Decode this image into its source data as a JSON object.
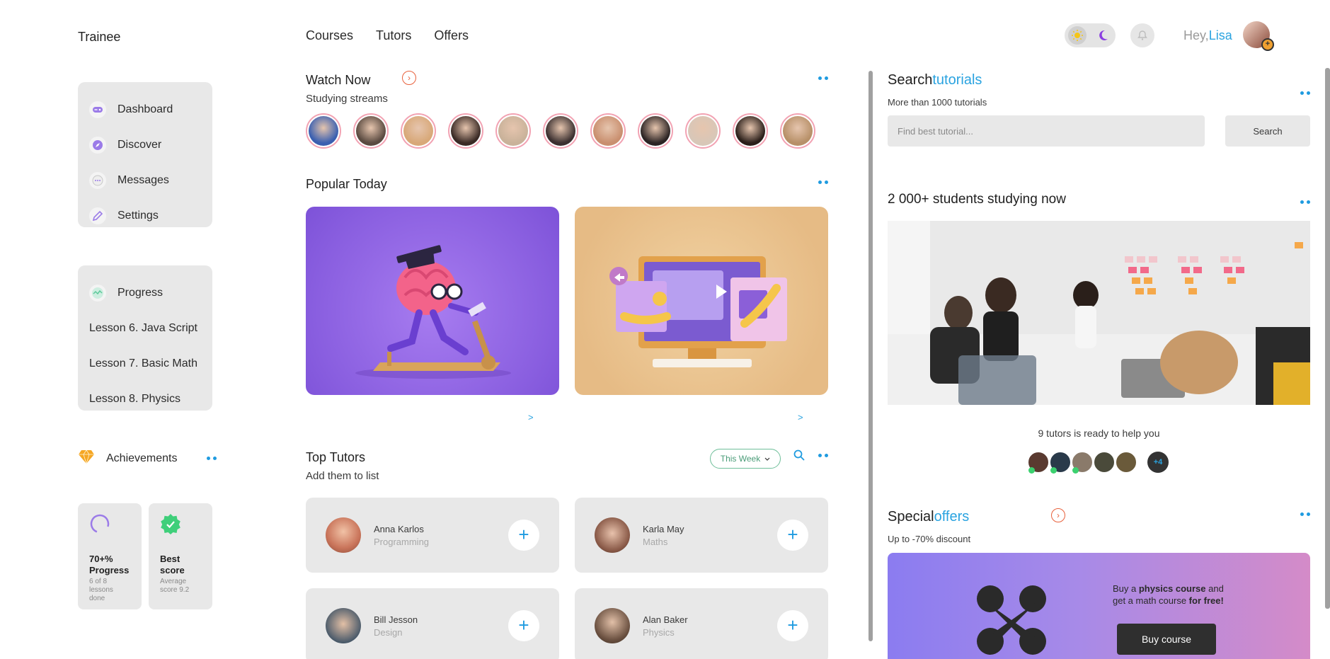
{
  "app": {
    "title": "Trainee"
  },
  "topnav": {
    "items": [
      "Courses",
      "Tutors",
      "Offers"
    ]
  },
  "header": {
    "greeting": "Hey,",
    "user_name": "Lisa"
  },
  "sidebar": {
    "menu": [
      {
        "label": "Dashboard",
        "icon": "gamepad-icon"
      },
      {
        "label": "Discover",
        "icon": "compass-icon"
      },
      {
        "label": "Messages",
        "icon": "chat-icon"
      },
      {
        "label": "Settings",
        "icon": "pencil-icon"
      }
    ],
    "progress": {
      "label": "Progress",
      "lessons": [
        "Lesson 6. Java Script",
        "Lesson 7. Basic Math",
        "Lesson 8. Physics"
      ]
    },
    "achievements": {
      "label": "Achievements",
      "cards": [
        {
          "title": "70+% Progress",
          "subtitle": "6 of 8 lessons done"
        },
        {
          "title": "Best score",
          "subtitle": "Average score 9.2"
        }
      ]
    }
  },
  "watch_now": {
    "title": "Watch Now",
    "subtitle": "Studying streams",
    "stream_colors": [
      "#3a5fb0",
      "#5a4a40",
      "#d8a878",
      "#3a2a25",
      "#c9b29a",
      "#3b3030",
      "#c98f6f",
      "#2c2424",
      "#d8c7b8",
      "#2b1f1a",
      "#b79068"
    ]
  },
  "popular_today": {
    "title": "Popular Today"
  },
  "top_tutors": {
    "title": "Top Tutors",
    "subtitle": "Add them to list",
    "filter": "This Week",
    "tutors": [
      {
        "name": "Anna Karlos",
        "subject": "Programming",
        "color": "#c9745a"
      },
      {
        "name": "Karla May",
        "subject": "Maths",
        "color": "#8a5a48"
      },
      {
        "name": "Bill Jesson",
        "subject": "Design",
        "color": "#4a5a6a"
      },
      {
        "name": "Alan Baker",
        "subject": "Physics",
        "color": "#6a5040"
      }
    ]
  },
  "search_tutorials": {
    "title_main": "Search",
    "title_accent": "tutorials",
    "subtitle": "More than 1000 tutorials",
    "placeholder": "Find best tutorial...",
    "button": "Search"
  },
  "students": {
    "title": "2 000+ students studying now",
    "tutors_ready": "9 tutors is ready to help you",
    "more_count": "+4"
  },
  "special_offers": {
    "title_main": "Special",
    "title_accent": "offers",
    "subtitle": "Up to -70% discount",
    "promo_pre": "Buy a ",
    "promo_bold1": "physics course",
    "promo_mid": " and",
    "promo_line2": "get a math course ",
    "promo_bold2": "for free!",
    "button": "Buy course"
  },
  "colors": {
    "accent": "#2aa3e0",
    "arrow": "#e8613c",
    "card_bg": "#e8e8e8"
  }
}
